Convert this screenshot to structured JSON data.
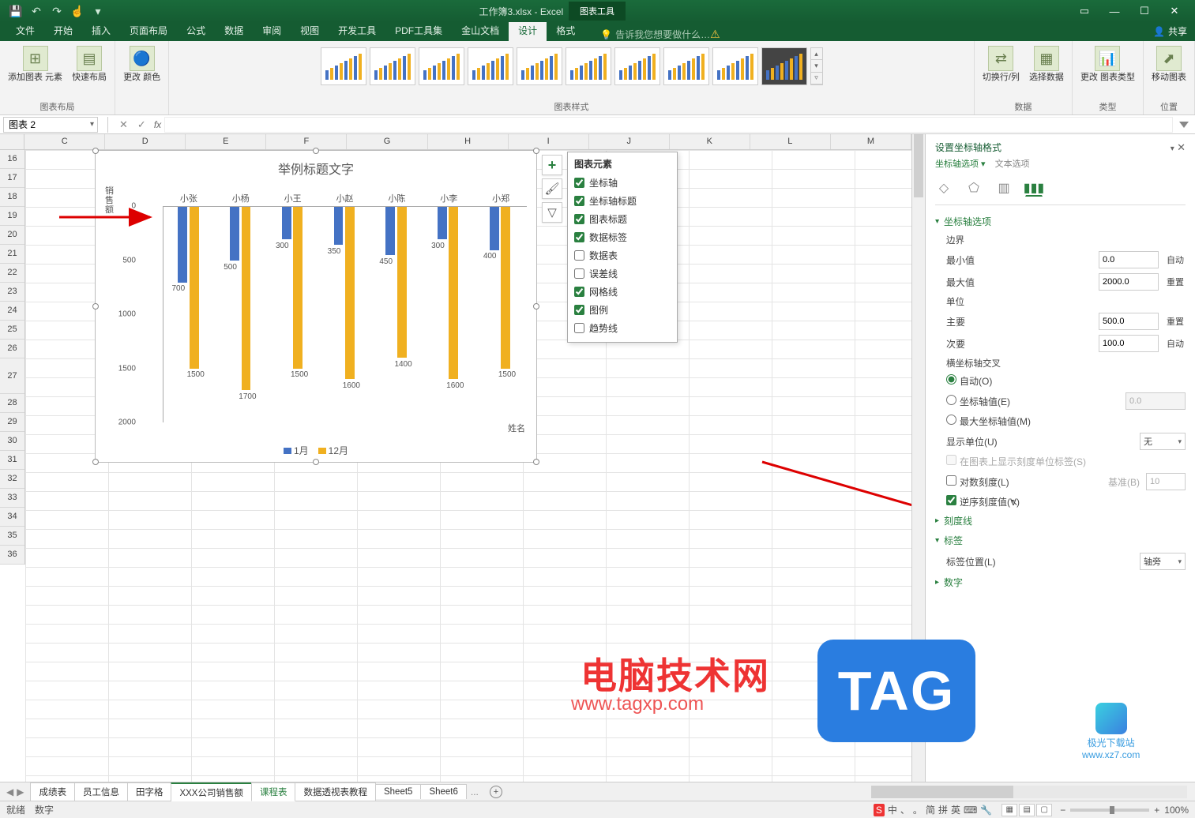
{
  "title_bar": {
    "app_title": "工作簿3.xlsx - Excel",
    "chart_tools": "图表工具",
    "qat": [
      "save-icon",
      "undo-icon",
      "redo-icon",
      "touch-icon",
      "more-icon"
    ]
  },
  "ribbon": {
    "tabs": [
      "文件",
      "开始",
      "插入",
      "页面布局",
      "公式",
      "数据",
      "审阅",
      "视图",
      "开发工具",
      "PDF工具集",
      "金山文档",
      "设计",
      "格式"
    ],
    "active": "设计",
    "tell_me": "告诉我您想要做什么…",
    "share": "共享",
    "groups": {
      "layout": {
        "add_element": "添加图表\n元素",
        "quick_layout": "快速布局",
        "label": "图表布局"
      },
      "colors": {
        "btn": "更改\n颜色"
      },
      "styles": {
        "label": "图表样式"
      },
      "data": {
        "switch": "切换行/列",
        "select": "选择数据",
        "label": "数据"
      },
      "type": {
        "btn": "更改\n图表类型",
        "label": "类型"
      },
      "location": {
        "btn": "移动图表",
        "label": "位置"
      }
    }
  },
  "formula": {
    "name_box": "图表 2",
    "fx": "fx"
  },
  "columns": [
    "C",
    "D",
    "E",
    "F",
    "G",
    "H",
    "I",
    "J",
    "K",
    "L",
    "M"
  ],
  "rows": [
    16,
    17,
    18,
    19,
    20,
    21,
    22,
    23,
    24,
    25,
    26,
    27,
    28,
    29,
    30,
    31,
    32,
    33,
    34,
    35,
    36
  ],
  "chart_side_btns": [
    "+",
    "brush-icon",
    "funnel-icon"
  ],
  "chart_elements": {
    "title": "图表元素",
    "items": [
      {
        "label": "坐标轴",
        "checked": true
      },
      {
        "label": "坐标轴标题",
        "checked": true
      },
      {
        "label": "图表标题",
        "checked": true
      },
      {
        "label": "数据标签",
        "checked": true
      },
      {
        "label": "数据表",
        "checked": false
      },
      {
        "label": "误差线",
        "checked": false
      },
      {
        "label": "网格线",
        "checked": true
      },
      {
        "label": "图例",
        "checked": true
      },
      {
        "label": "趋势线",
        "checked": false
      }
    ]
  },
  "chart_data": {
    "type": "bar",
    "title": "举例标题文字",
    "ylabel": "销售额",
    "xlabel": "姓名",
    "categories": [
      "小张",
      "小杨",
      "小王",
      "小赵",
      "小陈",
      "小李",
      "小郑"
    ],
    "series": [
      {
        "name": "1月",
        "values": [
          700,
          500,
          300,
          350,
          450,
          300,
          400
        ],
        "color": "#4472c4"
      },
      {
        "name": "12月",
        "values": [
          1500,
          1700,
          1500,
          1600,
          1400,
          1600,
          1500
        ],
        "color": "#f0b020"
      }
    ],
    "y_ticks": [
      0,
      500,
      1000,
      1500,
      2000
    ],
    "ylim": [
      0,
      2000
    ],
    "y_reversed": true
  },
  "side_panel": {
    "title": "设置坐标轴格式",
    "axis_options": "坐标轴选项",
    "text_options": "文本选项",
    "sections": {
      "axis_options_head": "坐标轴选项",
      "bounds": "边界",
      "min": "最小值",
      "min_val": "0.0",
      "min_btn": "自动",
      "max": "最大值",
      "max_val": "2000.0",
      "max_btn": "重置",
      "units": "单位",
      "major": "主要",
      "major_val": "500.0",
      "major_btn": "重置",
      "minor": "次要",
      "minor_val": "100.0",
      "minor_btn": "自动",
      "cross": "横坐标轴交叉",
      "cross_auto": "自动(O)",
      "cross_val": "坐标轴值(E)",
      "cross_val_input": "0.0",
      "cross_max": "最大坐标轴值(M)",
      "display_units": "显示单位(U)",
      "display_units_val": "无",
      "show_label_on_chart": "在图表上显示刻度单位标签(S)",
      "log_scale": "对数刻度(L)",
      "log_base_lbl": "基准(B)",
      "log_base": "10",
      "reverse": "逆序刻度值(V)",
      "tick_marks": "刻度线",
      "labels": "标签",
      "label_pos": "标签位置(L)",
      "label_pos_val": "轴旁",
      "number": "数字"
    }
  },
  "sheet_tabs": {
    "nav": [
      "◀",
      "▶"
    ],
    "tabs": [
      "成绩表",
      "员工信息",
      "田字格",
      "XXX公司销售额",
      "课程表",
      "数据透视表教程",
      "Sheet5",
      "Sheet6"
    ],
    "active_index": 3,
    "ellipsis": "...",
    "plus": "+"
  },
  "status": {
    "ready": "就绪",
    "numlock": "数字",
    "ime_icons": [
      "中",
      "、",
      "。",
      "简",
      "拼",
      "英",
      "⌨"
    ],
    "zoom_out": "−",
    "zoom_in": "+",
    "zoom_val": "100%"
  },
  "watermark": {
    "t1": "电脑技术网",
    "t2": "www.tagxp.com",
    "tag": "TAG",
    "dl_label": "极光下载站",
    "dl_url": "www.xz7.com"
  }
}
